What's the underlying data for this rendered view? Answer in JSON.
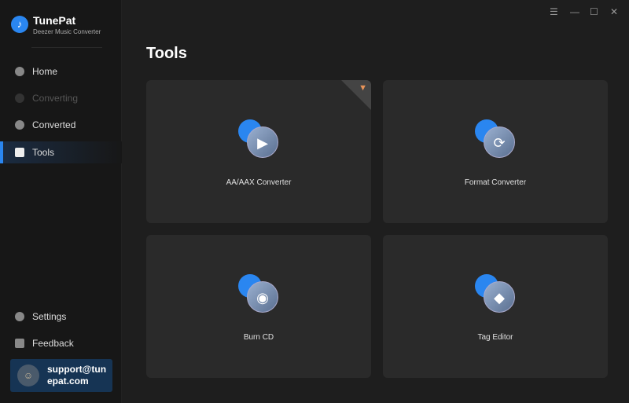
{
  "app": {
    "name": "TunePat",
    "subtitle": "Deezer Music Converter"
  },
  "nav": [
    {
      "label": "Home"
    },
    {
      "label": "Converting"
    },
    {
      "label": "Converted"
    },
    {
      "label": "Tools"
    }
  ],
  "bottom_nav": [
    {
      "label": "Settings"
    },
    {
      "label": "Feedback"
    }
  ],
  "account": {
    "email": "support@tunepat.com"
  },
  "window": {
    "menu": "☰",
    "minimize": "—",
    "maximize": "☐",
    "close": "✕"
  },
  "page": {
    "title": "Tools"
  },
  "tools": [
    {
      "label": "AA/AAX Converter",
      "glyph": "▶"
    },
    {
      "label": "Format Converter",
      "glyph": "⟳"
    },
    {
      "label": "Burn CD",
      "glyph": "◉"
    },
    {
      "label": "Tag Editor",
      "glyph": "◆"
    }
  ]
}
